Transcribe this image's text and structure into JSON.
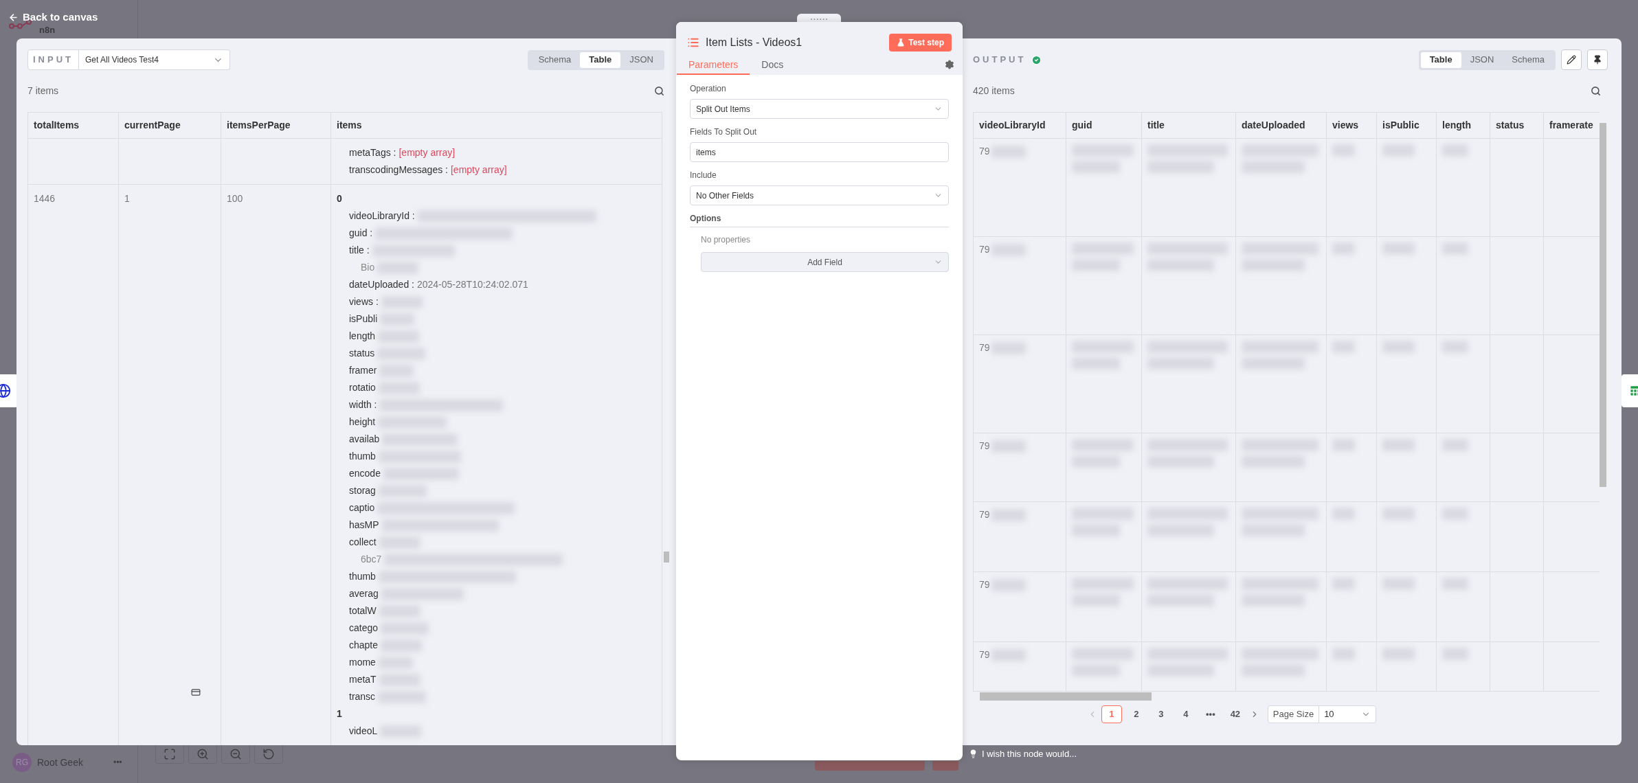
{
  "canvas": {
    "back_link": "Back to canvas",
    "logo_text": "n8n",
    "user": {
      "initials": "RG",
      "name": "Root Geek",
      "menu": "•••"
    }
  },
  "input": {
    "label": "INPUT",
    "node_select": "Get All Videos Test4",
    "view_tabs": [
      {
        "label": "Schema",
        "selected": false
      },
      {
        "label": "Table",
        "selected": true
      },
      {
        "label": "JSON",
        "selected": false
      }
    ],
    "count": "7 items",
    "table": {
      "columns": [
        "totalItems",
        "currentPage",
        "itemsPerPage",
        "items"
      ],
      "rows": [
        {
          "cells": [
            "",
            "",
            ""
          ],
          "items": [
            {
              "kind": "empty",
              "key": "metaTags :",
              "value": "[empty array]",
              "blurred": false
            },
            {
              "kind": "empty",
              "key": "transcodingMessages :",
              "value": "[empty array]",
              "blurred": false
            }
          ]
        },
        {
          "cells": [
            "1446",
            "1",
            "100"
          ],
          "items": [
            {
              "kind": "index",
              "key": "0",
              "blurred": false
            },
            {
              "kind": "field",
              "key": "videoLibraryId :",
              "blurred": true
            },
            {
              "kind": "field",
              "key": "guid :",
              "blurred": true
            },
            {
              "kind": "field",
              "key": "title :",
              "blurred": true
            },
            {
              "kind": "continuation",
              "key": "Bio",
              "blurred": true
            },
            {
              "kind": "field",
              "key": "dateUploaded :",
              "value": "2024-05-28T10:24:02.071",
              "blurred": false
            },
            {
              "kind": "field",
              "key": "views :",
              "blurred": true
            },
            {
              "kind": "field",
              "key": "isPubli",
              "blurred": true
            },
            {
              "kind": "field",
              "key": "length",
              "blurred": true
            },
            {
              "kind": "field",
              "key": "status",
              "blurred": true
            },
            {
              "kind": "field",
              "key": "framer",
              "blurred": true
            },
            {
              "kind": "field",
              "key": "rotatio",
              "blurred": true
            },
            {
              "kind": "field",
              "key": "width :",
              "blurred": true
            },
            {
              "kind": "field",
              "key": "height",
              "blurred": true
            },
            {
              "kind": "field",
              "key": "availab",
              "blurred": true
            },
            {
              "kind": "field",
              "key": "thumb",
              "blurred": true
            },
            {
              "kind": "field",
              "key": "encode",
              "blurred": true
            },
            {
              "kind": "field",
              "key": "storag",
              "blurred": true
            },
            {
              "kind": "field",
              "key": "captio",
              "blurred": true
            },
            {
              "kind": "field",
              "key": "hasMP",
              "blurred": true
            },
            {
              "kind": "field",
              "key": "collect",
              "blurred": true
            },
            {
              "kind": "continuation",
              "key": "6bc7",
              "blurred": true
            },
            {
              "kind": "field",
              "key": "thumb",
              "blurred": true
            },
            {
              "kind": "field",
              "key": "averag",
              "blurred": true
            },
            {
              "kind": "field",
              "key": "totalW",
              "blurred": true
            },
            {
              "kind": "field",
              "key": "catego",
              "blurred": true
            },
            {
              "kind": "field",
              "key": "chapte",
              "blurred": true
            },
            {
              "kind": "field",
              "key": "mome",
              "blurred": true
            },
            {
              "kind": "field",
              "key": "metaT",
              "blurred": true
            },
            {
              "kind": "field",
              "key": "transc",
              "blurred": true
            },
            {
              "kind": "index",
              "key": "1",
              "blurred": false
            },
            {
              "kind": "field",
              "key": "videoL",
              "blurred": true
            }
          ]
        }
      ]
    }
  },
  "node": {
    "title": "Item Lists - Videos1",
    "test_button": "Test step",
    "tabs": [
      {
        "label": "Parameters",
        "selected": true
      },
      {
        "label": "Docs",
        "selected": false
      }
    ],
    "parameters": [
      {
        "label": "Operation",
        "kind": "select",
        "value": "Split Out Items"
      },
      {
        "label": "Fields To Split Out",
        "kind": "input",
        "value": "items"
      },
      {
        "label": "Include",
        "kind": "select",
        "value": "No Other Fields"
      }
    ],
    "options": {
      "label": "Options",
      "empty_text": "No properties",
      "add_button": "Add Field"
    }
  },
  "output": {
    "label": "OUTPUT",
    "view_tabs": [
      {
        "label": "Table",
        "selected": true
      },
      {
        "label": "JSON",
        "selected": false
      },
      {
        "label": "Schema",
        "selected": false
      }
    ],
    "count": "420 items",
    "table": {
      "columns": [
        "videoLibraryId",
        "guid",
        "title",
        "dateUploaded",
        "views",
        "isPublic",
        "length",
        "status",
        "framerate"
      ],
      "rows": [
        {
          "cell": "79"
        },
        {
          "cell": "79"
        },
        {
          "cell": "79"
        },
        {
          "cell": "79"
        },
        {
          "cell": "79"
        },
        {
          "cell": "79"
        },
        {
          "cell": "79"
        }
      ]
    },
    "pagination": {
      "pages": [
        {
          "label": "1",
          "selected": true
        },
        {
          "label": "2",
          "selected": false
        },
        {
          "label": "3",
          "selected": false
        },
        {
          "label": "4",
          "selected": false
        },
        {
          "label": "•••",
          "selected": false
        },
        {
          "label": "42",
          "selected": false
        }
      ],
      "page_size_label": "Page Size",
      "page_size": "10"
    }
  },
  "feedback": "I wish this node would..."
}
